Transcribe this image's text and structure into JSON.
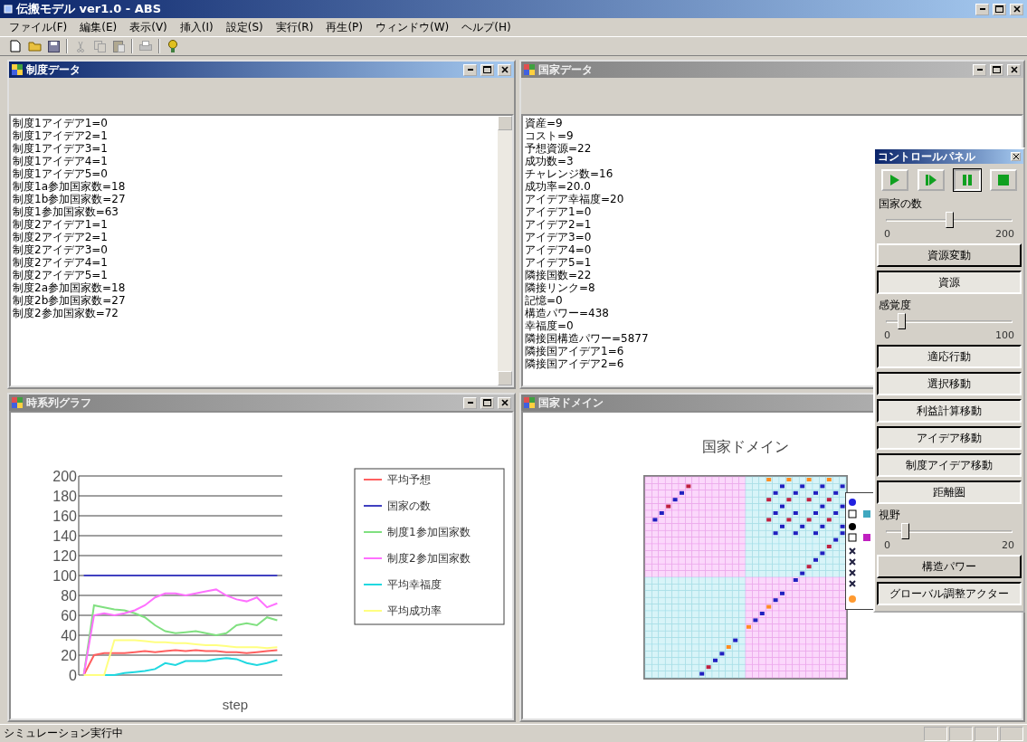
{
  "window": {
    "title": "伝搬モデル ver1.0 - ABS"
  },
  "menu": [
    "ファイル(F)",
    "編集(E)",
    "表示(V)",
    "挿入(I)",
    "設定(S)",
    "実行(R)",
    "再生(P)",
    "ウィンドウ(W)",
    "ヘルプ(H)"
  ],
  "windows": [
    {
      "kind": "text_list",
      "title": "制度データ",
      "active": true,
      "lines": [
        "制度1アイデア1=0",
        "制度1アイデア2=1",
        "制度1アイデア3=1",
        "制度1アイデア4=1",
        "制度1アイデア5=0",
        "制度1a参加国家数=18",
        "制度1b参加国家数=27",
        "制度1参加国家数=63",
        "制度2アイデア1=1",
        "制度2アイデア2=1",
        "制度2アイデア3=0",
        "制度2アイデア4=1",
        "制度2アイデア5=1",
        "制度2a参加国家数=18",
        "制度2b参加国家数=27",
        "制度2参加国家数=72"
      ]
    },
    {
      "kind": "text_list",
      "title": "国家データ",
      "active": false,
      "lines": [
        "資産=9",
        "コスト=9",
        "予想資源=22",
        "成功数=3",
        "チャレンジ数=16",
        "成功率=20.0",
        "アイデア幸福度=20",
        "アイデア1=0",
        "アイデア2=1",
        "アイデア3=0",
        "アイデア4=0",
        "アイデア5=1",
        "隣接国数=22",
        "隣接リンク=8",
        "記憶=0",
        "構造パワー=438",
        "幸福度=0",
        "隣接国構造パワー=5877",
        "隣接国アイデア1=6",
        "隣接国アイデア2=6"
      ]
    },
    {
      "kind": "chart",
      "title": "時系列グラフ",
      "active": false,
      "chart_data": {
        "type": "line",
        "xlabel": "step",
        "grid": true,
        "legend": true,
        "ylim": [
          0,
          200
        ],
        "yticks": [
          0,
          20,
          40,
          60,
          80,
          100,
          120,
          140,
          160,
          180,
          200
        ],
        "series": [
          {
            "name": "平均予想",
            "color": "#ff6060",
            "values": [
              0,
              20,
              22,
              22,
              22,
              23,
              24,
              23,
              24,
              25,
              24,
              25,
              24,
              24,
              23,
              23,
              22,
              23,
              24,
              25
            ]
          },
          {
            "name": "国家の数",
            "color": "#4040c0",
            "values": [
              100,
              100,
              100,
              100,
              100,
              100,
              100,
              100,
              100,
              100,
              100,
              100,
              100,
              100,
              100,
              100,
              100,
              100,
              100,
              100
            ]
          },
          {
            "name": "制度1参加国家数",
            "color": "#80e080",
            "values": [
              0,
              70,
              68,
              66,
              65,
              62,
              58,
              50,
              44,
              42,
              43,
              44,
              42,
              40,
              42,
              50,
              52,
              50,
              58,
              55
            ]
          },
          {
            "name": "制度2参加国家数",
            "color": "#ff70ff",
            "values": [
              0,
              60,
              62,
              60,
              62,
              65,
              70,
              78,
              82,
              82,
              80,
              82,
              84,
              86,
              80,
              76,
              74,
              78,
              68,
              72
            ]
          },
          {
            "name": "平均幸福度",
            "color": "#20d8e0",
            "values": [
              0,
              0,
              0,
              0,
              2,
              3,
              4,
              6,
              12,
              10,
              14,
              14,
              14,
              16,
              17,
              16,
              12,
              10,
              12,
              15
            ]
          },
          {
            "name": "平均成功率",
            "color": "#ffff80",
            "values": [
              0,
              0,
              0,
              35,
              35,
              35,
              34,
              33,
              33,
              32,
              32,
              31,
              30,
              30,
              29,
              28,
              28,
              28,
              27,
              28
            ]
          }
        ]
      }
    },
    {
      "kind": "domain",
      "title": "国家ドメイン",
      "active": false,
      "map_title": "国家ドメイン"
    }
  ],
  "control_panel": {
    "title": "コントロールパネル",
    "media_buttons": [
      {
        "kind": "play",
        "selected": false
      },
      {
        "kind": "step",
        "selected": false
      },
      {
        "kind": "pause",
        "selected": true
      },
      {
        "kind": "stop",
        "selected": false
      }
    ],
    "items": [
      {
        "kind": "slider",
        "label": "国家の数",
        "level": 0.5,
        "min_label": "0",
        "max_label": "200"
      },
      {
        "kind": "toggle",
        "label": "資源変動",
        "pressed": false
      },
      {
        "kind": "toggle",
        "label": "資源",
        "pressed": true
      },
      {
        "kind": "slider",
        "label": "感覚度",
        "level": 0.12,
        "min_label": "0",
        "max_label": "100"
      },
      {
        "kind": "toggle",
        "label": "適応行動",
        "pressed": true
      },
      {
        "kind": "toggle",
        "label": "選択移動",
        "pressed": true
      },
      {
        "kind": "toggle",
        "label": "利益計算移動",
        "pressed": true
      },
      {
        "kind": "toggle",
        "label": "アイデア移動",
        "pressed": true
      },
      {
        "kind": "toggle",
        "label": "制度アイデア移動",
        "pressed": true
      },
      {
        "kind": "toggle",
        "label": "距離圏",
        "pressed": true
      },
      {
        "kind": "slider",
        "label": "視野",
        "level": 0.15,
        "min_label": "0",
        "max_label": "20"
      },
      {
        "kind": "toggle",
        "label": "構造パワー",
        "pressed": false
      },
      {
        "kind": "toggle",
        "label": "グローバル調整アクター",
        "pressed": true
      }
    ]
  },
  "status_bar": {
    "text": "シミュレーション実行中"
  }
}
